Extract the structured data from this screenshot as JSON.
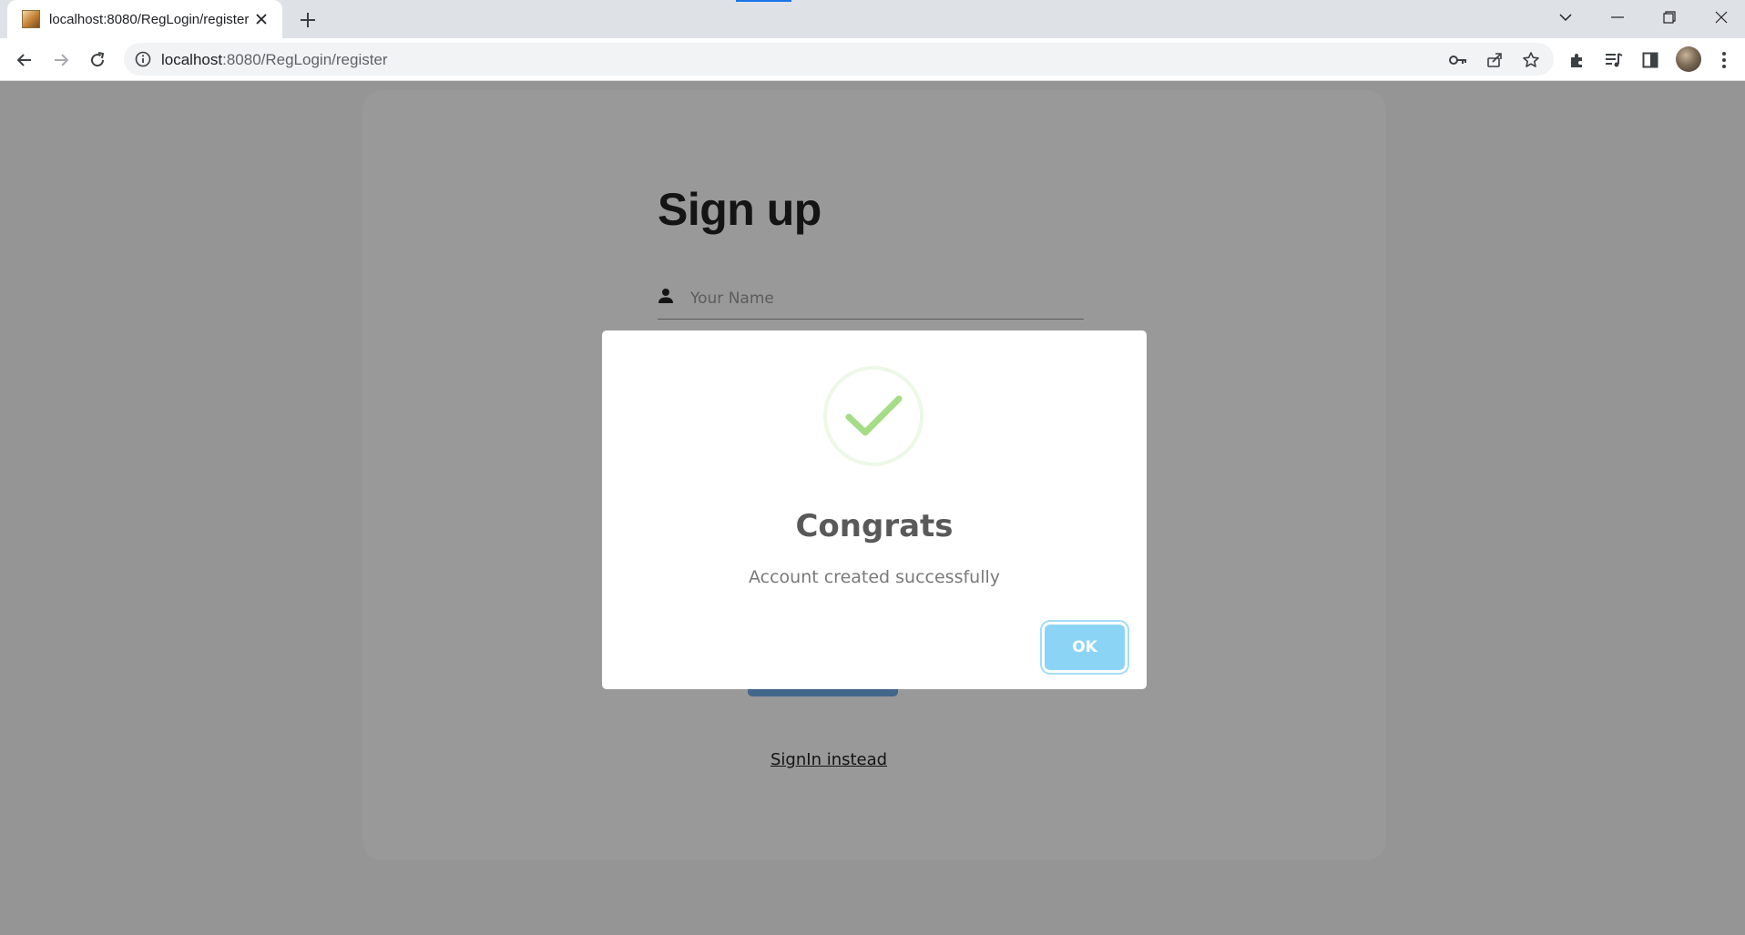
{
  "browser": {
    "tab_title": "localhost:8080/RegLogin/register",
    "url_host": "localhost",
    "url_rest": ":8080/RegLogin/register"
  },
  "page": {
    "heading": "Sign up",
    "name_placeholder": "Your Name",
    "signin_link": "SignIn instead"
  },
  "modal": {
    "title": "Congrats",
    "message": "Account created successfully",
    "ok_label": "OK",
    "icon": "success-check-icon"
  },
  "colors": {
    "success_green": "#a5dc86",
    "ok_button": "#8cd4f5",
    "register_button": "#6dabe4"
  }
}
